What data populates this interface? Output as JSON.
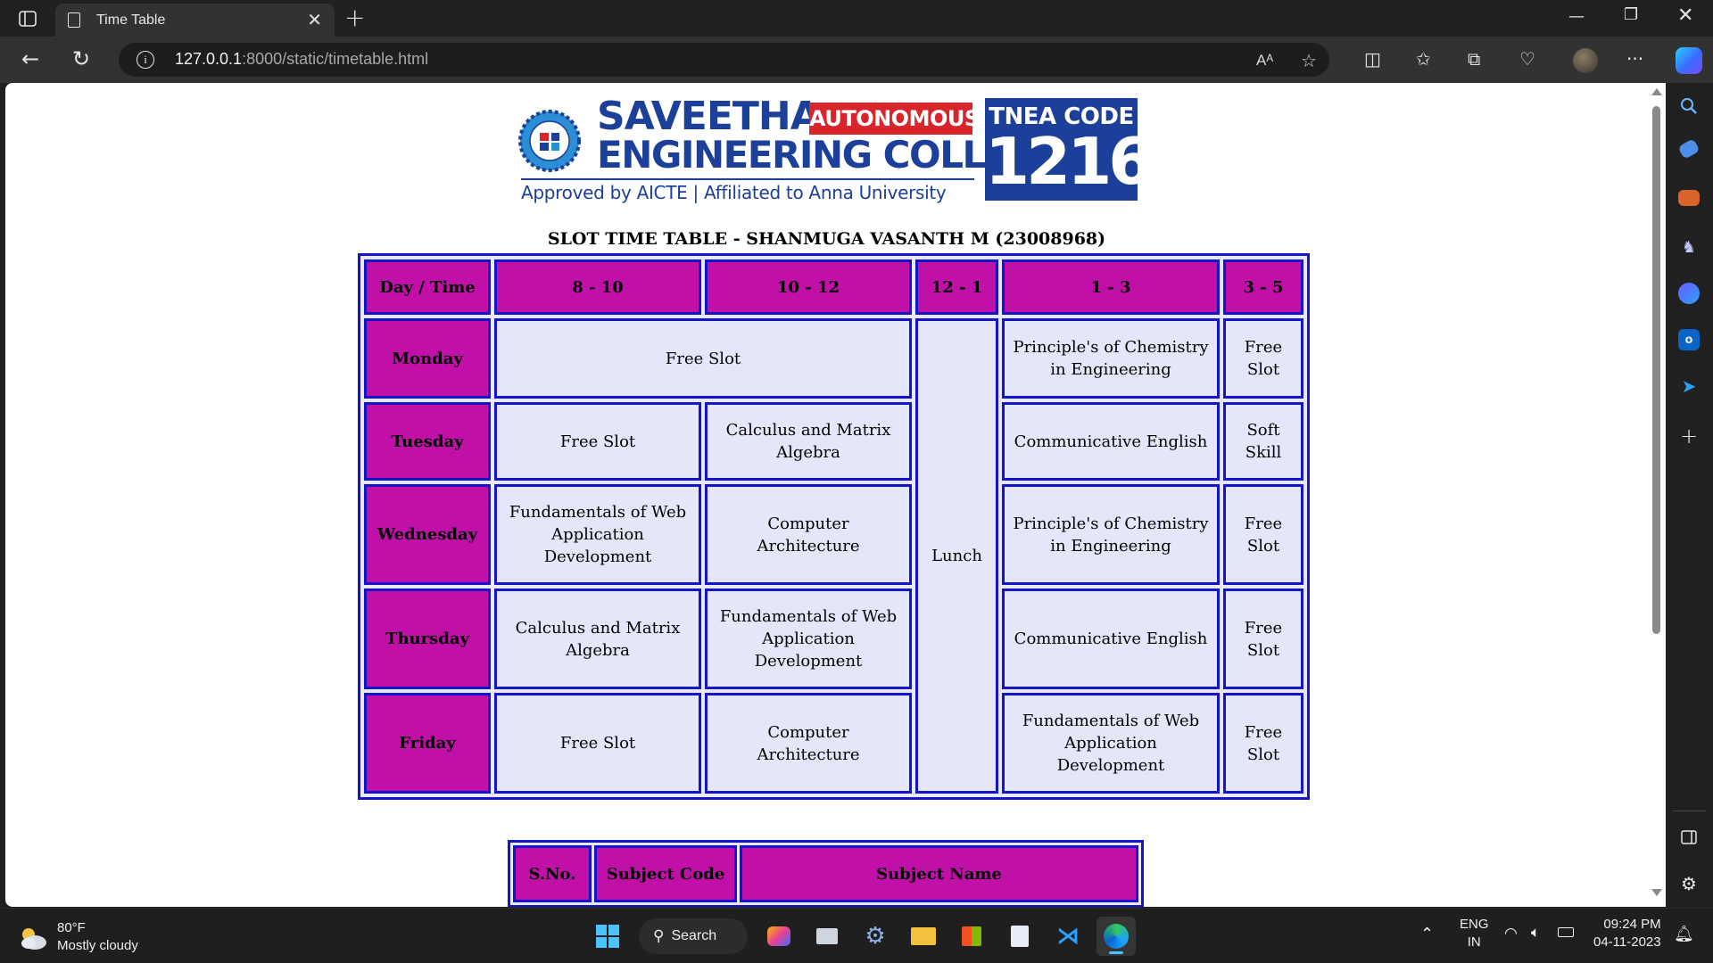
{
  "browser": {
    "tab_title": "Time Table",
    "url_host": "127.0.0.1",
    "url_rest": ":8000/static/timetable.html"
  },
  "college": {
    "name_line1": "SAVEETHA",
    "badge": "AUTONOMOUS",
    "name_line2": "ENGINEERING COLLEGE",
    "tagline": "Approved by AICTE  |  Affiliated to Anna University",
    "tnea_label": "TNEA CODE",
    "tnea_code": "1216",
    "seal_text": "SAVEETHA"
  },
  "timetable": {
    "heading": "SLOT TIME TABLE - SHANMUGA VASANTH M (23008968)",
    "headers": [
      "Day / Time",
      "8 - 10",
      "10 - 12",
      "12 - 1",
      "1 - 3",
      "3 - 5"
    ],
    "lunch": "Lunch",
    "rows": [
      {
        "day": "Monday",
        "s1": "Free Slot",
        "s3": "Principle's of Chemistry in Engineering",
        "s4": "Free Slot"
      },
      {
        "day": "Tuesday",
        "s1": "Free Slot",
        "s2": "Calculus and Matrix Algebra",
        "s3": "Communicative English",
        "s4": "Soft Skill"
      },
      {
        "day": "Wednesday",
        "s1": "Fundamentals of Web Application Development",
        "s2": "Computer Architecture",
        "s3": "Principle's of Chemistry in Engineering",
        "s4": "Free Slot"
      },
      {
        "day": "Thursday",
        "s1": "Calculus and Matrix Algebra",
        "s2": "Fundamentals of Web Application Development",
        "s3": "Communicative English",
        "s4": "Free Slot"
      },
      {
        "day": "Friday",
        "s1": "Free Slot",
        "s2": "Computer Architecture",
        "s3": "Fundamentals of Web Application Development",
        "s4": "Free Slot"
      }
    ]
  },
  "subjects": {
    "headers": [
      "S.No.",
      "Subject Code",
      "Subject Name"
    ]
  },
  "taskbar": {
    "temp": "80°F",
    "weather": "Mostly cloudy",
    "search": "Search",
    "lang1": "ENG",
    "lang2": "IN",
    "time": "09:24 PM",
    "date": "04-11-2023"
  },
  "colors": {
    "header_bg": "#c010a8",
    "cell_bg": "#e6e6fa",
    "border": "#1414c8",
    "brand_blue": "#1c3f9a",
    "brand_red": "#d8252c"
  }
}
